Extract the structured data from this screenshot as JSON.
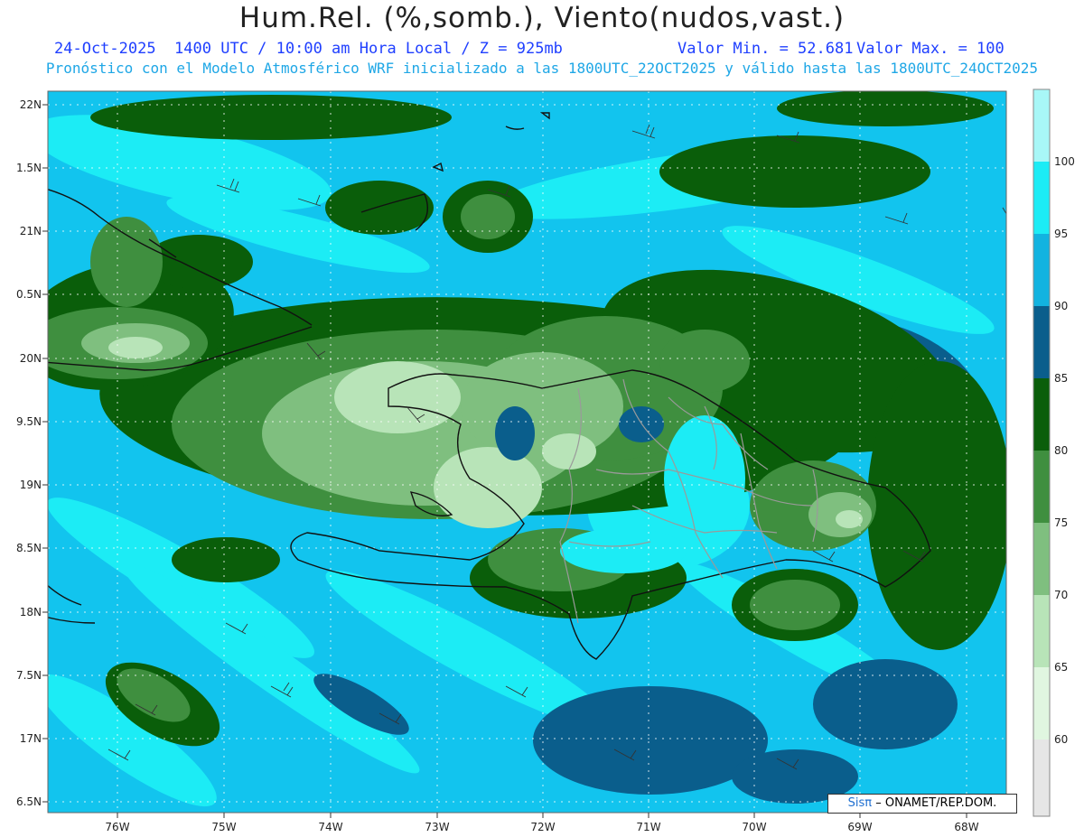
{
  "header": {
    "title": "Hum.Rel. (%,somb.), Viento(nudos,vast.)",
    "date_line": "24-Oct-2025  1400 UTC / 10:00 am Hora Local / Z = 925mb",
    "min_label": "Valor Min. = 52.681",
    "max_label": "Valor Max. = 100",
    "model_line": "Pronóstico con el Modelo Atmosférico WRF inicializado a las 1800UTC_22OCT2025 y válido hasta las  1800UTC_24OCT2025"
  },
  "axes": {
    "lat_labels": [
      "22N",
      "1.5N",
      "21N",
      "0.5N",
      "20N",
      "9.5N",
      "19N",
      "8.5N",
      "18N",
      "7.5N",
      "17N",
      "6.5N"
    ],
    "lon_labels": [
      "76W",
      "75W",
      "74W",
      "73W",
      "72W",
      "71W",
      "70W",
      "69W",
      "68W"
    ]
  },
  "colorbar": {
    "labels": [
      "100",
      "95",
      "90",
      "85",
      "80",
      "75",
      "70",
      "65",
      "60"
    ],
    "colors": [
      "#a8f7f7",
      "#1cecf5",
      "#12b3e0",
      "#0a5e8c",
      "#0a5e0a",
      "#3f8f3f",
      "#7fbf7f",
      "#b8e4b8",
      "#e0f6e0",
      "#e6e6e6"
    ]
  },
  "credit": {
    "brand": "Sisπ",
    "text": "– ONAMET/REP.DOM."
  },
  "map_colors": {
    "ocean_base": "#12c4ee",
    "humid_high": "#1cecf5",
    "mid_blue": "#12b3e0",
    "dark_blue": "#0a5e8c",
    "dark_green": "#0a5e0a",
    "mid_green": "#3f8f3f",
    "light_green": "#7fbf7f",
    "pale_green": "#b8e4b8",
    "coast": "#111111",
    "provinces": "#9a9a9a"
  }
}
